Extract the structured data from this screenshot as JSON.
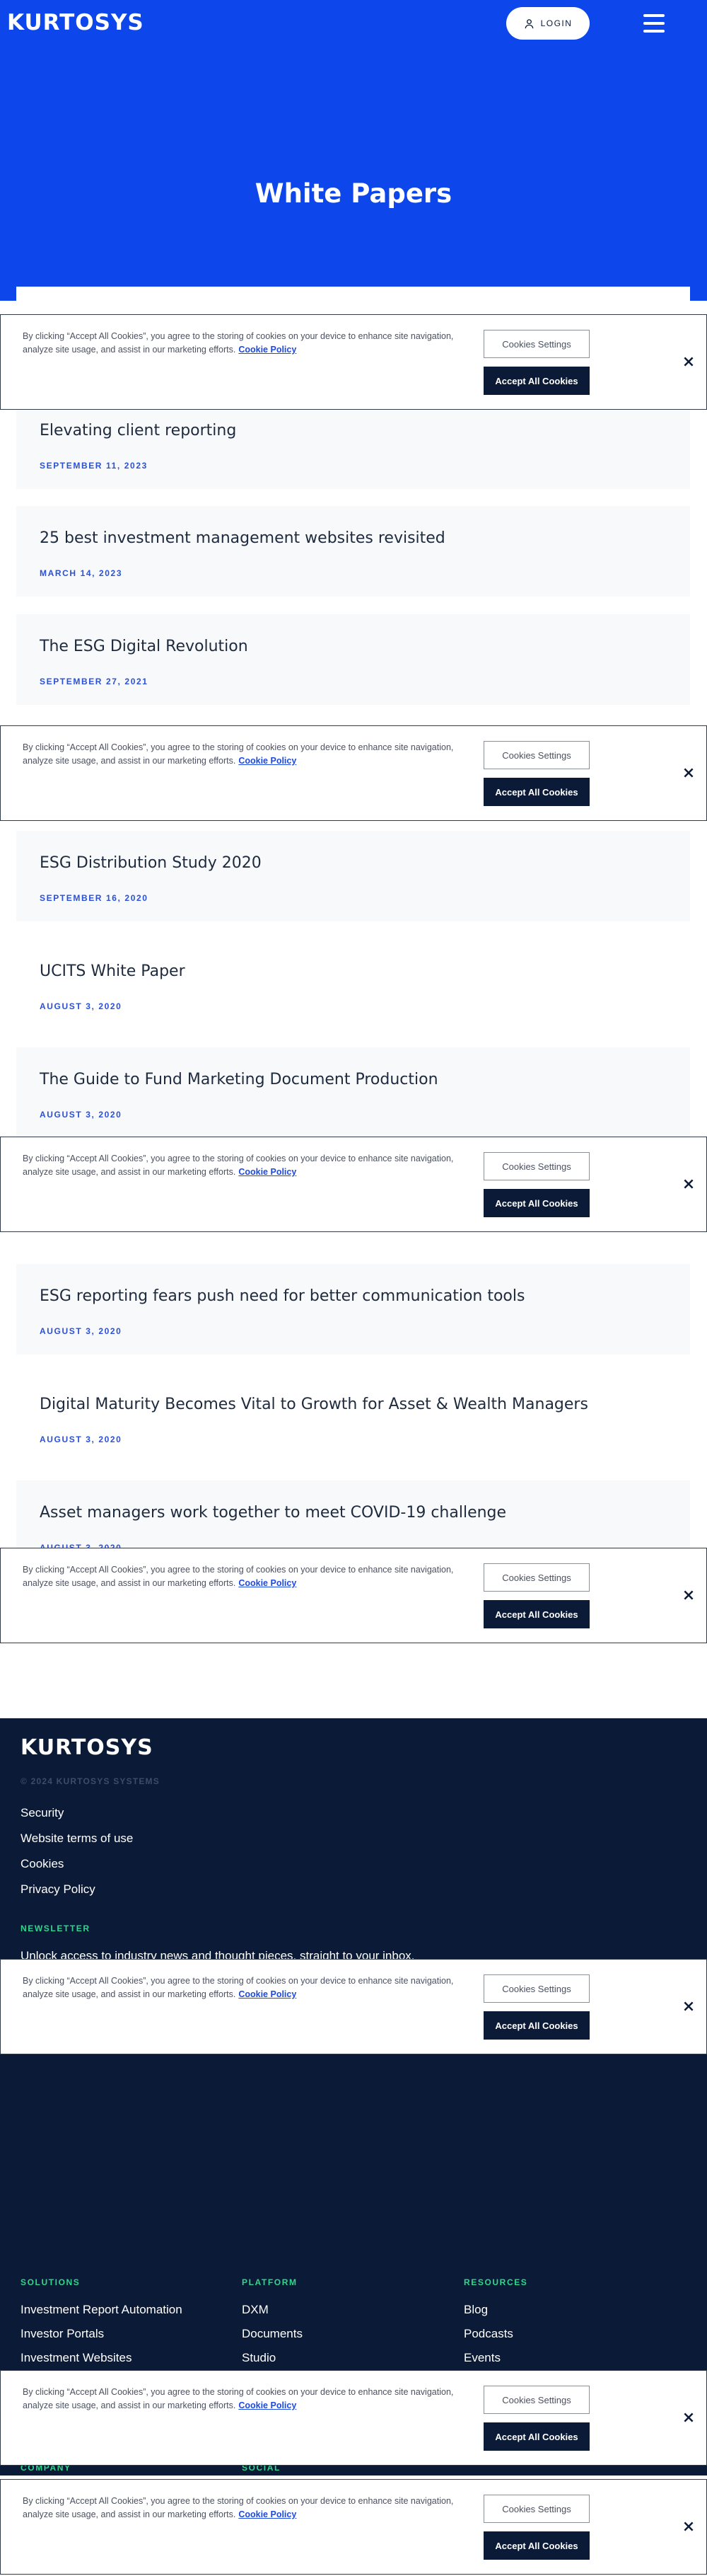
{
  "header": {
    "logo": "KURTOSYS",
    "login_label": "LOGIN",
    "menu_icon": "hamburger-icon"
  },
  "hero": {
    "title": "White Papers"
  },
  "articles": [
    {
      "title": "Elevating client reporting",
      "date": "SEPTEMBER 11, 2023"
    },
    {
      "title": "25 best investment management websites revisited",
      "date": "MARCH 14, 2023"
    },
    {
      "title": "The ESG Digital Revolution",
      "date": "SEPTEMBER 27, 2021"
    },
    {
      "title": "ESG Distribution Study 2020",
      "date": "SEPTEMBER 16, 2020"
    },
    {
      "title": "UCITS White Paper",
      "date": "AUGUST 3, 2020"
    },
    {
      "title": "The Guide to Fund Marketing Document Production",
      "date": "AUGUST 3, 2020"
    },
    {
      "title": "ESG reporting fears push need for better communication tools",
      "date": "AUGUST 3, 2020"
    },
    {
      "title": "Digital Maturity Becomes Vital to Growth for Asset & Wealth Managers",
      "date": "AUGUST 3, 2020"
    },
    {
      "title": "Asset managers work together to meet COVID-19 challenge",
      "date": "AUGUST 3, 2020"
    }
  ],
  "cookie": {
    "text": "By clicking “Accept All Cookies”, you agree to the storing of cookies on your device to enhance site navigation, analyze site usage, and assist in our marketing efforts.",
    "link": "Cookie Policy",
    "settings_label": "Cookies Settings",
    "accept_label": "Accept All Cookies"
  },
  "footer": {
    "logo": "KURTOSYS",
    "copyright": "© 2024 KURTOSYS SYSTEMS",
    "links": [
      "Security",
      "Website terms of use",
      "Cookies",
      "Privacy Policy"
    ],
    "newsletter_heading": "NEWSLETTER",
    "newsletter_text": "Unlock access to industry news and thought pieces, straight to your inbox.",
    "columns": [
      {
        "heading": "SOLUTIONS",
        "items": [
          "Investment Report Automation",
          "Investor Portals",
          "Investment Websites"
        ]
      },
      {
        "heading": "PLATFORM",
        "items": [
          "DXM",
          "Documents",
          "Studio"
        ]
      },
      {
        "heading": "RESOURCES",
        "items": [
          "Blog",
          "Podcasts",
          "Events"
        ]
      }
    ],
    "company_heading": "COMPANY",
    "social_heading": "SOCIAL"
  },
  "colors": {
    "brand_blue": "#0d46ea",
    "navy": "#0b1a36",
    "accent_green": "#2fd78b",
    "link_blue": "#1d4ae0"
  }
}
